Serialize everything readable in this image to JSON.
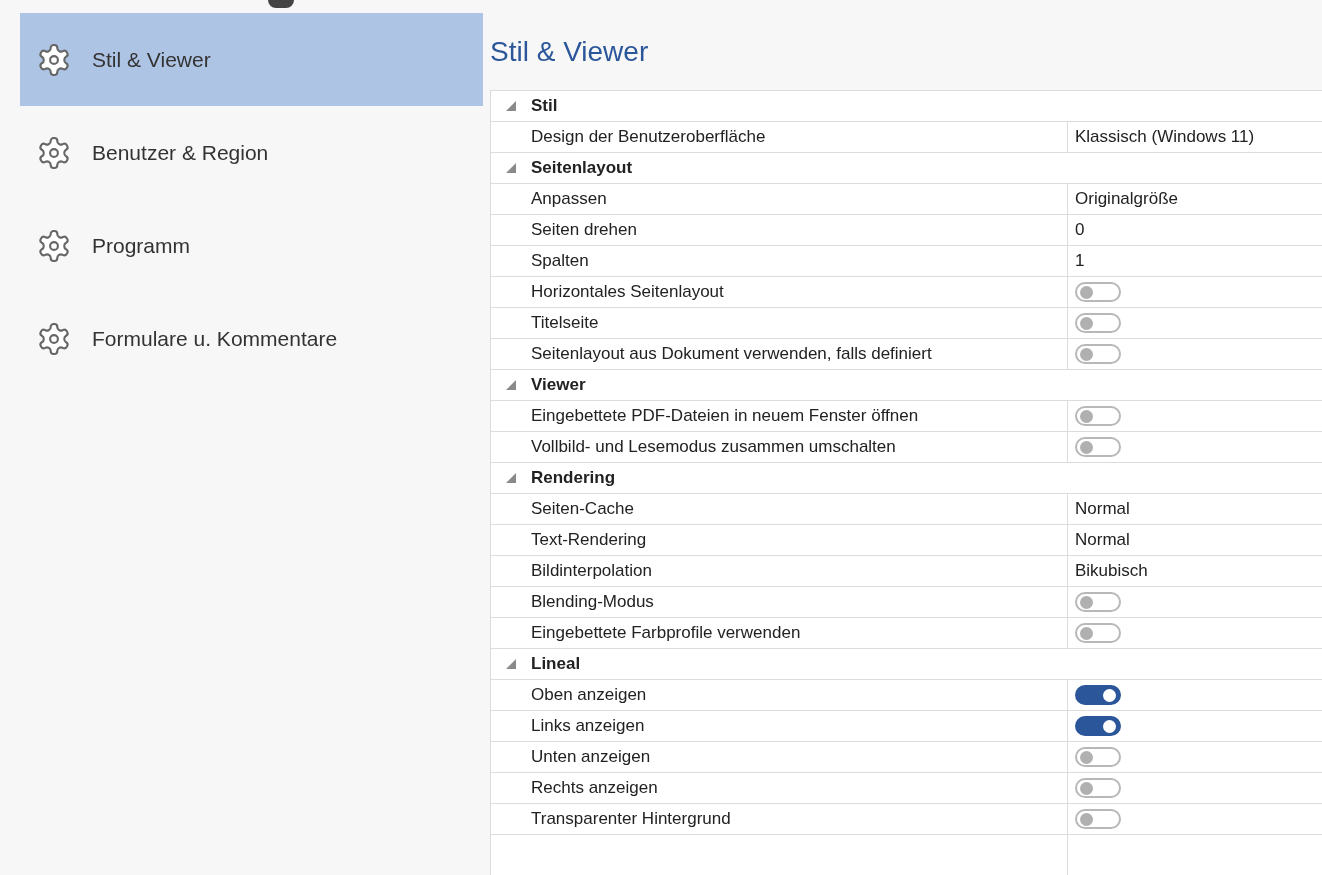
{
  "sidebar": {
    "items": [
      {
        "label": "Stil & Viewer",
        "selected": true
      },
      {
        "label": "Benutzer & Region",
        "selected": false
      },
      {
        "label": "Programm",
        "selected": false
      },
      {
        "label": "Formulare u. Kommentare",
        "selected": false
      }
    ]
  },
  "page_title": "Stil & Viewer",
  "groups": [
    {
      "title": "Stil",
      "expanded": true,
      "rows": [
        {
          "label": "Design der Benutzeroberfläche",
          "kind": "text",
          "value": "Klassisch (Windows 11)"
        }
      ]
    },
    {
      "title": "Seitenlayout",
      "expanded": true,
      "rows": [
        {
          "label": "Anpassen",
          "kind": "text",
          "value": "Originalgröße"
        },
        {
          "label": "Seiten drehen",
          "kind": "text",
          "value": "0"
        },
        {
          "label": "Spalten",
          "kind": "text",
          "value": "1"
        },
        {
          "label": "Horizontales Seitenlayout",
          "kind": "toggle",
          "on": false
        },
        {
          "label": "Titelseite",
          "kind": "toggle",
          "on": false
        },
        {
          "label": "Seitenlayout aus Dokument verwenden, falls definiert",
          "kind": "toggle",
          "on": false
        }
      ]
    },
    {
      "title": "Viewer",
      "expanded": true,
      "rows": [
        {
          "label": "Eingebettete PDF-Dateien in neuem Fenster öffnen",
          "kind": "toggle",
          "on": false
        },
        {
          "label": "Vollbild- und Lesemodus zusammen umschalten",
          "kind": "toggle",
          "on": false
        }
      ]
    },
    {
      "title": "Rendering",
      "expanded": true,
      "rows": [
        {
          "label": "Seiten-Cache",
          "kind": "text",
          "value": "Normal"
        },
        {
          "label": "Text-Rendering",
          "kind": "text",
          "value": "Normal"
        },
        {
          "label": "Bildinterpolation",
          "kind": "text",
          "value": "Bikubisch"
        },
        {
          "label": "Blending-Modus",
          "kind": "toggle",
          "on": false
        },
        {
          "label": "Eingebettete Farbprofile verwenden",
          "kind": "toggle",
          "on": false
        }
      ]
    },
    {
      "title": "Lineal",
      "expanded": true,
      "rows": [
        {
          "label": "Oben anzeigen",
          "kind": "toggle",
          "on": true
        },
        {
          "label": "Links anzeigen",
          "kind": "toggle",
          "on": true
        },
        {
          "label": "Unten anzeigen",
          "kind": "toggle",
          "on": false
        },
        {
          "label": "Rechts anzeigen",
          "kind": "toggle",
          "on": false
        },
        {
          "label": "Transparenter Hintergrund",
          "kind": "toggle",
          "on": false
        }
      ]
    }
  ]
}
